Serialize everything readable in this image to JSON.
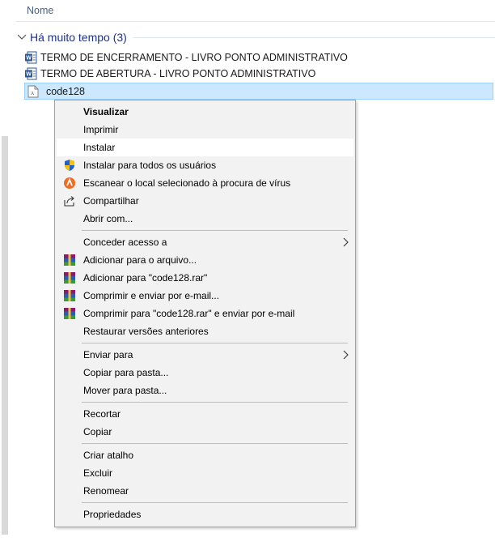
{
  "header": {
    "column_name": "Nome"
  },
  "group": {
    "title": "Há muito tempo (3)"
  },
  "files": [
    {
      "name": "TERMO DE ENCERRAMENTO - LIVRO PONTO ADMINISTRATIVO",
      "icon": "word-document-icon"
    },
    {
      "name": "TERMO DE ABERTURA - LIVRO PONTO ADMINISTRATIVO",
      "icon": "word-document-icon"
    },
    {
      "name": "code128",
      "icon": "font-file-icon",
      "selected": true
    }
  ],
  "context_menu": {
    "items": [
      {
        "label": "Visualizar",
        "bold": true
      },
      {
        "label": "Imprimir"
      },
      {
        "label": "Instalar",
        "highlighted": true
      },
      {
        "label": "Instalar para todos os usuários",
        "icon": "uac-shield-icon"
      },
      {
        "label": "Escanear o local selecionado à procura de vírus",
        "icon": "avast-icon"
      },
      {
        "label": "Compartilhar",
        "icon": "share-icon"
      },
      {
        "label": "Abrir com..."
      },
      {
        "label": "Conceder acesso a",
        "submenu": true
      },
      {
        "label": "Adicionar para o arquivo...",
        "icon": "winrar-icon"
      },
      {
        "label": "Adicionar para \"code128.rar\"",
        "icon": "winrar-icon"
      },
      {
        "label": "Comprimir e enviar por e-mail...",
        "icon": "winrar-icon"
      },
      {
        "label": "Comprimir para \"code128.rar\" e enviar por e-mail",
        "icon": "winrar-icon"
      },
      {
        "label": "Restaurar versões anteriores"
      },
      {
        "label": "Enviar para",
        "submenu": true
      },
      {
        "label": "Copiar para pasta..."
      },
      {
        "label": "Mover para pasta..."
      },
      {
        "label": "Recortar"
      },
      {
        "label": "Copiar"
      },
      {
        "label": "Criar atalho"
      },
      {
        "label": "Excluir"
      },
      {
        "label": "Renomear"
      },
      {
        "label": "Propriedades"
      }
    ]
  },
  "colors": {
    "selection": "#cce8ff",
    "group_title": "#1e3287",
    "menu_bg": "#f2f2f2"
  }
}
